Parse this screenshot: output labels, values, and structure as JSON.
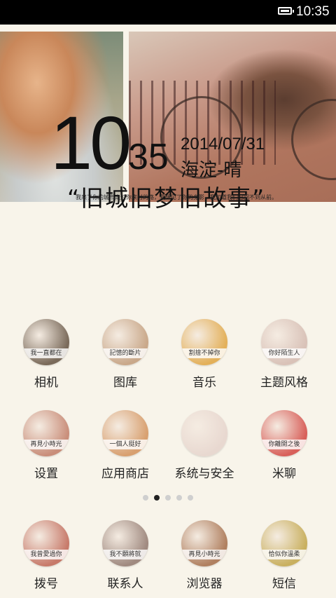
{
  "status_bar": {
    "time": "10:35",
    "battery_level": 1.0
  },
  "lock_widget": {
    "hour": "10",
    "minute": "35",
    "date": "2014/07/31",
    "weather": "海淀-晴",
    "slogan": "“旧城旧梦旧故事”",
    "caption": "我来了你的城市走过你来时的路，我想见了你的身影，我知道我们已回不到从前。"
  },
  "pager": {
    "pages": 5,
    "active_index": 1
  },
  "apps": [
    {
      "label": "相机",
      "caption": "我一直都在",
      "icon": "camera-icon",
      "color": "#7a6a5a"
    },
    {
      "label": "图库",
      "caption": "記憶的斷片",
      "icon": "gallery-icon",
      "color": "#c9a88a"
    },
    {
      "label": "音乐",
      "caption": "割捨不掉你",
      "icon": "music-icon",
      "color": "#e3b05a"
    },
    {
      "label": "主题风格",
      "caption": "你好陌生人",
      "icon": "theme-icon",
      "color": "#d9c2b8"
    },
    {
      "label": "设置",
      "caption": "再見小時光",
      "icon": "settings-icon",
      "color": "#c98e7a"
    },
    {
      "label": "应用商店",
      "caption": "一個人挺好",
      "icon": "app-store-icon",
      "color": "#d8a070"
    },
    {
      "label": "系统与安全",
      "caption": "",
      "icon": "security-icon",
      "color": "#e8d8d0"
    },
    {
      "label": "米聊",
      "caption": "你離開之後",
      "icon": "miliao-icon",
      "color": "#d8605a"
    },
    {
      "label": "拨号",
      "caption": "我曾愛過你",
      "icon": "dialer-icon",
      "color": "#c77a6a"
    },
    {
      "label": "联系人",
      "caption": "我不願將就",
      "icon": "contacts-icon",
      "color": "#a08a80"
    },
    {
      "label": "浏览器",
      "caption": "再見小時光",
      "icon": "browser-icon",
      "color": "#b08060"
    },
    {
      "label": "短信",
      "caption": "恰似你溫柔",
      "icon": "messages-icon",
      "color": "#c9b060"
    }
  ]
}
